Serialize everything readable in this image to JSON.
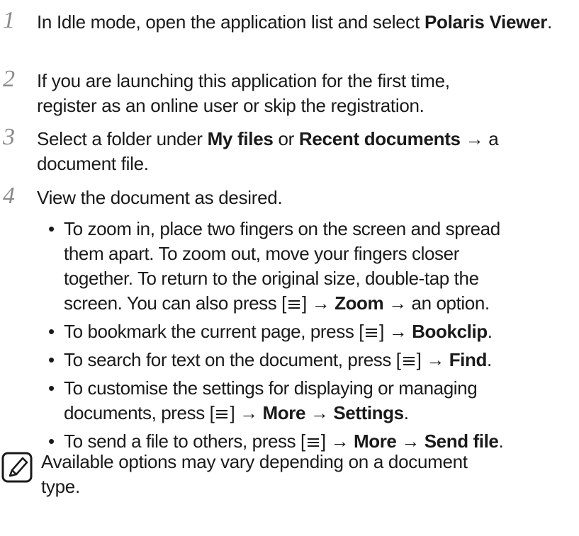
{
  "steps": [
    {
      "number": "1",
      "parts": [
        "In Idle mode, open the application list and select ",
        "Polaris Viewer",
        "."
      ]
    },
    {
      "number": "2",
      "line1": "If you are launching this application for the first time,",
      "line2": "register as an online user or skip the registration."
    },
    {
      "number": "3",
      "parts": [
        "Select a folder under ",
        "My files",
        " or ",
        "Recent documents",
        " → a document file."
      ]
    },
    {
      "number": "4",
      "text": "View the document as desired."
    }
  ],
  "bullets": {
    "zoom": {
      "line1": "To zoom in, place two fingers on the screen and spread",
      "line2": "them apart. To zoom out, move your fingers closer",
      "line3": "together. To return to the original size, double-tap the",
      "line4_pre": "screen. You can also press [",
      "line4_mid": "] → ",
      "line4_bold": "Zoom",
      "line4_post": " → an option."
    },
    "bookmark": {
      "pre": "To bookmark the current page, press [",
      "mid": "] → ",
      "bold": "Bookclip",
      "post": "."
    },
    "search": {
      "pre": "To search for text on the document, press [",
      "mid": "] → ",
      "bold": "Find",
      "post": "."
    },
    "settings": {
      "line1": "To customise the settings for displaying or managing",
      "pre": "documents, press [",
      "mid": "] → ",
      "bold1": "More",
      "arrow": " → ",
      "bold2": "Settings",
      "post": "."
    },
    "send": {
      "pre": "To send a file to others, press [",
      "mid": "] → ",
      "bold1": "More",
      "arrow": " → ",
      "bold2": "Send file",
      "post": "."
    }
  },
  "note": {
    "line1": "Available options may vary depending on a document",
    "line2": "type."
  },
  "icons": {
    "menu": "menu-key-icon",
    "note": "note-pen-icon"
  }
}
